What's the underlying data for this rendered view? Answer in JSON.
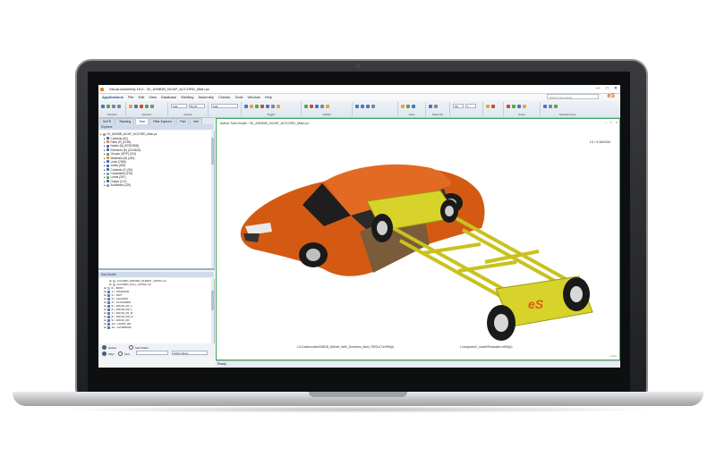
{
  "window": {
    "title": "Visual-Assembly 16.0 - 00_ASMDB_NCAP_ACCORD_Main.pc",
    "controls": [
      "—",
      "□",
      "✕"
    ]
  },
  "menu": {
    "items": [
      "Applications",
      "File",
      "Edit",
      "View",
      "Database",
      "Welding",
      "Assembly",
      "Checks",
      "Tools",
      "Window",
      "Help"
    ],
    "search_placeholder": "Search commands"
  },
  "ribbon": {
    "groups": [
      "Standard",
      "Selection",
      "Analysis",
      "",
      "Toggles",
      "Visibility",
      "",
      "Views",
      "Model Info",
      "",
      "",
      "Nodes",
      "Standard Group"
    ],
    "combos": [
      "Add",
      "By ID",
      "Add",
      "3D",
      "1"
    ]
  },
  "left_tabs": [
    "SwTR",
    "Stacking",
    "Tree",
    "Filter Explorer",
    "Part",
    "Info"
  ],
  "explorer": {
    "title": "Explorer",
    "path": "00_ASMDB_NCAP_ACCORD_Main.pc",
    "items": [
      {
        "label": "00_ASMDB_NCAP_ACCORD_Main.pc",
        "icon": "orange",
        "indent": 0
      },
      {
        "label": "Contents (62)",
        "icon": "blue",
        "indent": 1
      },
      {
        "label": "Parts (P) (2759)",
        "icon": "orange",
        "indent": 1
      },
      {
        "label": "Nodes (N) (97302505)",
        "icon": "blue",
        "indent": 1
      },
      {
        "label": "Elements (E) (2214624)",
        "icon": "blue",
        "indent": 1
      },
      {
        "label": "Groups (GRP) (214)",
        "icon": "green",
        "indent": 1
      },
      {
        "label": "Materials (M) (262)",
        "icon": "orange",
        "indent": 1
      },
      {
        "label": "Links (7965)",
        "icon": "blue",
        "indent": 1
      },
      {
        "label": "Joints (208)",
        "icon": "blue",
        "indent": 1
      },
      {
        "label": "Contacts (C) (53)",
        "icon": "blue",
        "indent": 1
      },
      {
        "label": "Constraints (578)",
        "icon": "gray",
        "indent": 1
      },
      {
        "label": "Loads (257)",
        "icon": "green",
        "indent": 1
      },
      {
        "label": "Output (170)",
        "icon": "blue",
        "indent": 1
      },
      {
        "label": "Auxiliaries (220)",
        "icon": "gray",
        "indent": 1
      }
    ]
  },
  "submodel": {
    "title": "Sub-Model",
    "items": [
      {
        "label": "ACCORD_DRIVER_DUMMY_CRTAC.inc",
        "sel": false
      },
      {
        "label": "ACCORD_FULL_CRTAC.inc",
        "sel": false
      },
      {
        "label": "0<- BODY",
        "sel": false
      },
      {
        "label": "1<- INTERIOR",
        "sel": true
      },
      {
        "label": "2<- PWT",
        "sel": true
      },
      {
        "label": "3<- CHASSIS",
        "sel": true
      },
      {
        "label": "4<- CLOSURES",
        "sel": true
      },
      {
        "label": "5<- DOOR_FR_L",
        "sel": true
      },
      {
        "label": "6<- DOOR_RR_L",
        "sel": true
      },
      {
        "label": "7<- DOOR_FR_R",
        "sel": true
      },
      {
        "label": "8<- DOOR_RR_R",
        "sel": true
      },
      {
        "label": "9<- HOOD_FR",
        "sel": true
      },
      {
        "label": "10<- HOOD_RR",
        "sel": true
      },
      {
        "label": "11<- EXTERIOR",
        "sel": true
      }
    ],
    "radio_global": "Global",
    "radio_submodel": "Sub-Model",
    "filter_label": "Filter",
    "find_label": "Find",
    "entity_label": "Entity Name"
  },
  "viewport": {
    "active_submodel": "Active Sub-Model : 00_ASMDB_NCAP_ACCORD_Main.pc",
    "time_readout": "13 / 0.060000",
    "footer_left": "L3:Crashmodel/ASMDB_NMvert_With_Dummies_Main_RESULT.erfH5(A)",
    "footer_right": "L4:segment2_model/Finalstate.erfH5(A)",
    "corner_label": "Front",
    "logo_text": "eS",
    "colors": {
      "car_body": "#d45a14",
      "chassis": "#d8d32a",
      "border": "#3fa85a"
    }
  },
  "status": {
    "text": "Ready"
  }
}
